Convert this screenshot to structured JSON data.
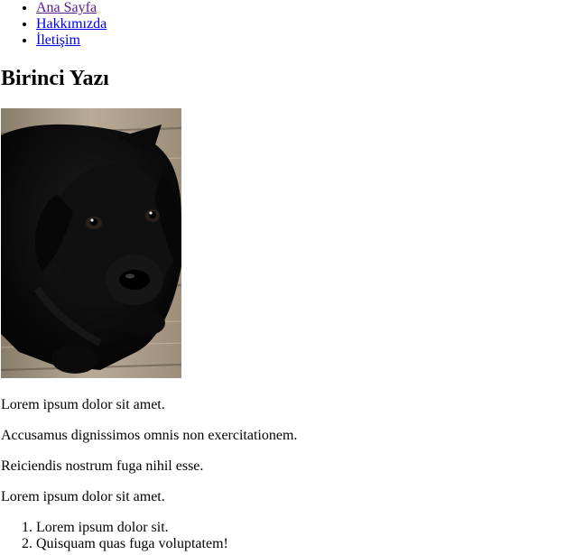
{
  "nav": {
    "items": [
      {
        "label": "Ana Sayfa"
      },
      {
        "label": "Hakkımızda"
      },
      {
        "label": "İletişim"
      }
    ]
  },
  "post": {
    "title": "Birinci Yazı",
    "image_subject": "black-puppy",
    "paragraphs": [
      "Lorem ipsum dolor sit amet.",
      "Accusamus dignissimos omnis non exercitationem.",
      "Reiciendis nostrum fuga nihil esse.",
      "Lorem ipsum dolor sit amet."
    ],
    "list": [
      "Lorem ipsum dolor sit.",
      "Quisquam quas fuga voluptatem!"
    ]
  },
  "colors": {
    "visited_link": "#551a8b",
    "link": "#0000ee"
  }
}
